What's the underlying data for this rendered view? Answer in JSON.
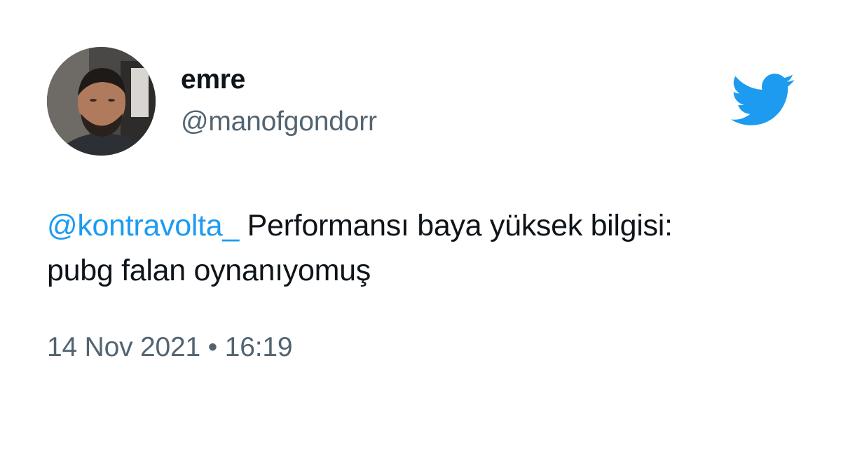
{
  "author": {
    "display_name": "emre",
    "handle": "@manofgondorr"
  },
  "tweet": {
    "mention": "@kontravolta_",
    "text_line1_rest": " Performansı baya yüksek bilgisi:",
    "text_line2": "pubg falan oynanıyomuş"
  },
  "meta": {
    "date": "14 Nov 2021",
    "separator": "•",
    "time": "16:19"
  },
  "icons": {
    "logo": "twitter-bird-icon"
  },
  "colors": {
    "brand": "#1d9bf0",
    "text": "#0f1419",
    "secondary": "#536471"
  }
}
